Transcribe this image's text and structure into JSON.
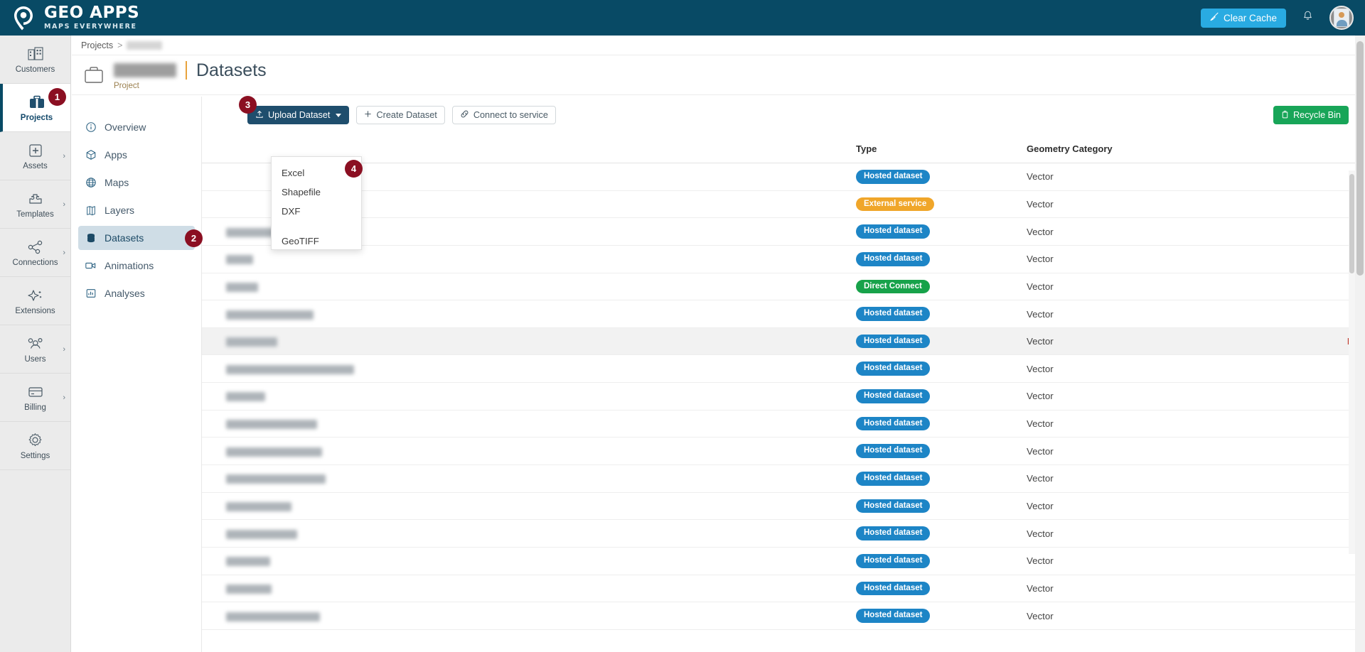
{
  "brand": {
    "name": "GEO APPS",
    "tagline": "MAPS EVERYWHERE",
    "logo_icon": "location-pin-logo"
  },
  "colors": {
    "topbar": "#084a65",
    "clear_cache": "#29abe2",
    "primary_button": "#1f4e6d",
    "recycle_green": "#18a558",
    "pill_hosted": "#1d85c6",
    "pill_external": "#f0a62a",
    "pill_direct": "#17a24a",
    "callout_red": "#8b0f22",
    "delete_link": "#c0392b",
    "title_divider": "#e8a33d"
  },
  "topbar": {
    "clear_cache_label": "Clear Cache",
    "clear_cache_icon": "broom-icon",
    "notifications_icon": "bell-icon",
    "avatar_icon": "user-avatar"
  },
  "rail": {
    "items": [
      {
        "label": "Customers",
        "icon": "buildings-icon",
        "active": false,
        "chevron": false,
        "callout": null
      },
      {
        "label": "Projects",
        "icon": "briefcase-icon",
        "active": true,
        "chevron": false,
        "callout": "1"
      },
      {
        "label": "Assets",
        "icon": "plus-box-icon",
        "active": false,
        "chevron": true,
        "callout": null
      },
      {
        "label": "Templates",
        "icon": "puzzle-icon",
        "active": false,
        "chevron": true,
        "callout": null
      },
      {
        "label": "Connections",
        "icon": "share-nodes-icon",
        "active": false,
        "chevron": true,
        "callout": null
      },
      {
        "label": "Extensions",
        "icon": "sparkle-icon",
        "active": false,
        "chevron": false,
        "callout": null
      },
      {
        "label": "Users",
        "icon": "users-icon",
        "active": false,
        "chevron": true,
        "callout": null
      },
      {
        "label": "Billing",
        "icon": "credit-card-icon",
        "active": false,
        "chevron": true,
        "callout": null
      },
      {
        "label": "Settings",
        "icon": "gear-icon",
        "active": false,
        "chevron": false,
        "callout": null
      }
    ]
  },
  "breadcrumb": {
    "root_label": "Projects",
    "separator": ">",
    "current_label_redacted": true
  },
  "page_header": {
    "project_icon": "briefcase-outline-icon",
    "project_name_redacted": true,
    "project_subtitle": "Project",
    "title": "Datasets"
  },
  "project_nav": {
    "items": [
      {
        "label": "Overview",
        "icon": "info-circle-icon",
        "active": false,
        "callout": null
      },
      {
        "label": "Apps",
        "icon": "cube-icon",
        "active": false,
        "callout": null
      },
      {
        "label": "Maps",
        "icon": "globe-icon",
        "active": false,
        "callout": null
      },
      {
        "label": "Layers",
        "icon": "layers-icon",
        "active": false,
        "callout": null
      },
      {
        "label": "Datasets",
        "icon": "database-icon",
        "active": true,
        "callout": "2"
      },
      {
        "label": "Animations",
        "icon": "video-icon",
        "active": false,
        "callout": null
      },
      {
        "label": "Analyses",
        "icon": "chart-icon",
        "active": false,
        "callout": null
      }
    ]
  },
  "toolbar": {
    "upload_label": "Upload Dataset",
    "upload_icon": "upload-icon",
    "upload_callout": "3",
    "create_label": "Create Dataset",
    "create_icon": "plus-icon",
    "connect_label": "Connect to service",
    "connect_icon": "link-icon",
    "recycle_label": "Recycle Bin",
    "recycle_icon": "trash-icon"
  },
  "upload_dropdown": {
    "open": true,
    "callout": "4",
    "items": [
      {
        "label": "Excel"
      },
      {
        "label": "Shapefile"
      },
      {
        "label": "DXF"
      },
      {
        "label": "GeoTIFF"
      }
    ]
  },
  "table": {
    "columns": [
      "",
      "",
      "Type",
      "Geometry Category",
      ""
    ],
    "rows": [
      {
        "name_redacted": true,
        "name_width": 0,
        "type": "Hosted dataset",
        "type_style": "hosted",
        "geometry": "Vector",
        "action": "",
        "highlight": false
      },
      {
        "name_redacted": true,
        "name_width": 0,
        "type": "External service",
        "type_style": "external",
        "geometry": "Vector",
        "action": "",
        "highlight": false
      },
      {
        "name_redacted": true,
        "name_width": 105,
        "type": "Hosted dataset",
        "type_style": "hosted",
        "geometry": "Vector",
        "action": "",
        "highlight": false
      },
      {
        "name_redacted": true,
        "name_width": 38,
        "type": "Hosted dataset",
        "type_style": "hosted",
        "geometry": "Vector",
        "action": "",
        "highlight": false
      },
      {
        "name_redacted": true,
        "name_width": 45,
        "type": "Direct Connect",
        "type_style": "direct",
        "geometry": "Vector",
        "action": "",
        "highlight": false
      },
      {
        "name_redacted": true,
        "name_width": 123,
        "type": "Hosted dataset",
        "type_style": "hosted",
        "geometry": "Vector",
        "action": "",
        "highlight": false
      },
      {
        "name_redacted": true,
        "name_width": 72,
        "type": "Hosted dataset",
        "type_style": "hosted",
        "geometry": "Vector",
        "action": "Delete",
        "highlight": true
      },
      {
        "name_redacted": true,
        "name_width": 180,
        "type": "Hosted dataset",
        "type_style": "hosted",
        "geometry": "Vector",
        "action": "",
        "highlight": false
      },
      {
        "name_redacted": true,
        "name_width": 55,
        "type": "Hosted dataset",
        "type_style": "hosted",
        "geometry": "Vector",
        "action": "",
        "highlight": false
      },
      {
        "name_redacted": true,
        "name_width": 128,
        "type": "Hosted dataset",
        "type_style": "hosted",
        "geometry": "Vector",
        "action": "",
        "highlight": false
      },
      {
        "name_redacted": true,
        "name_width": 135,
        "type": "Hosted dataset",
        "type_style": "hosted",
        "geometry": "Vector",
        "action": "",
        "highlight": false
      },
      {
        "name_redacted": true,
        "name_width": 140,
        "type": "Hosted dataset",
        "type_style": "hosted",
        "geometry": "Vector",
        "action": "",
        "highlight": false
      },
      {
        "name_redacted": true,
        "name_width": 92,
        "type": "Hosted dataset",
        "type_style": "hosted",
        "geometry": "Vector",
        "action": "",
        "highlight": false
      },
      {
        "name_redacted": true,
        "name_width": 100,
        "type": "Hosted dataset",
        "type_style": "hosted",
        "geometry": "Vector",
        "action": "",
        "highlight": false
      },
      {
        "name_redacted": true,
        "name_width": 62,
        "type": "Hosted dataset",
        "type_style": "hosted",
        "geometry": "Vector",
        "action": "",
        "highlight": false
      },
      {
        "name_redacted": true,
        "name_width": 64,
        "type": "Hosted dataset",
        "type_style": "hosted",
        "geometry": "Vector",
        "action": "",
        "highlight": false
      },
      {
        "name_redacted": true,
        "name_width": 132,
        "type": "Hosted dataset",
        "type_style": "hosted",
        "geometry": "Vector",
        "action": "",
        "highlight": false
      }
    ],
    "type_header": "Type",
    "geometry_header": "Geometry Category"
  }
}
